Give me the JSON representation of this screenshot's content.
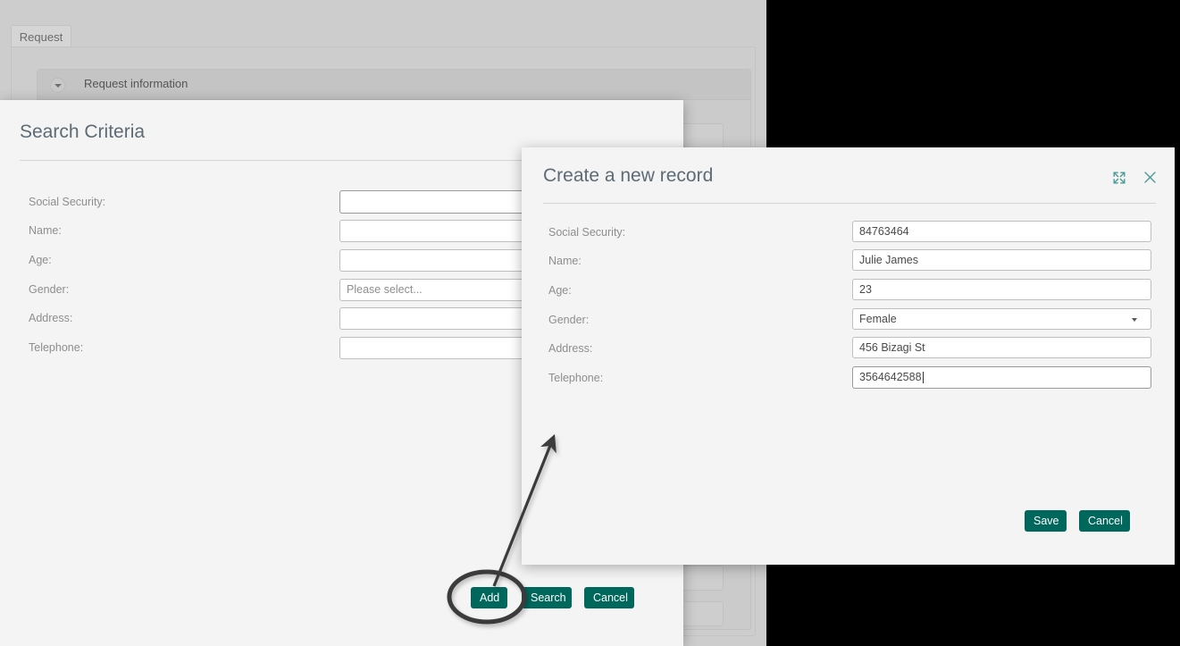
{
  "background": {
    "tab_label": "Request",
    "section_title": "Request information",
    "caret_icon": "chevron-down-icon",
    "panel_color": "#cdcdcd"
  },
  "search_dialog": {
    "title": "Search Criteria",
    "expand_icon": "expand-icon",
    "close_icon": "close-icon",
    "fields": [
      {
        "label": "Social Security:",
        "value": "",
        "placeholder": "",
        "type": "text"
      },
      {
        "label": "Name:",
        "value": "",
        "placeholder": "",
        "type": "text"
      },
      {
        "label": "Age:",
        "value": "",
        "placeholder": "",
        "type": "text"
      },
      {
        "label": "Gender:",
        "value": "Please select...",
        "placeholder": "Please select...",
        "type": "select"
      },
      {
        "label": "Address:",
        "value": "",
        "placeholder": "",
        "type": "text"
      },
      {
        "label": "Telephone:",
        "value": "",
        "placeholder": "",
        "type": "text"
      }
    ],
    "buttons": {
      "add": "Add",
      "search": "Search",
      "cancel": "Cancel"
    }
  },
  "create_dialog": {
    "title": "Create a new record",
    "expand_icon": "expand-icon",
    "close_icon": "close-icon",
    "fields": [
      {
        "label": "Social Security:",
        "value": "84763464",
        "type": "text"
      },
      {
        "label": "Name:",
        "value": "Julie James",
        "type": "text"
      },
      {
        "label": "Age:",
        "value": "23",
        "type": "text"
      },
      {
        "label": "Gender:",
        "value": "Female",
        "type": "select"
      },
      {
        "label": "Address:",
        "value": "456 Bizagi St",
        "type": "text"
      },
      {
        "label": "Telephone:",
        "value": "3564642588",
        "type": "text"
      }
    ],
    "buttons": {
      "save": "Save",
      "cancel": "Cancel"
    }
  },
  "annotations": {
    "highlight_target": "add-button",
    "arrow": "points-from-add-button-to-create-dialog"
  },
  "colors": {
    "accent": "#00675c",
    "dialog_bg": "#f4f4f4",
    "page_bg": "#cdcdcd",
    "title_text": "#5d6b75",
    "label_text": "#8e8e8e",
    "icon_teal": "#4a9b96",
    "annotation": "#3a3a3a"
  }
}
